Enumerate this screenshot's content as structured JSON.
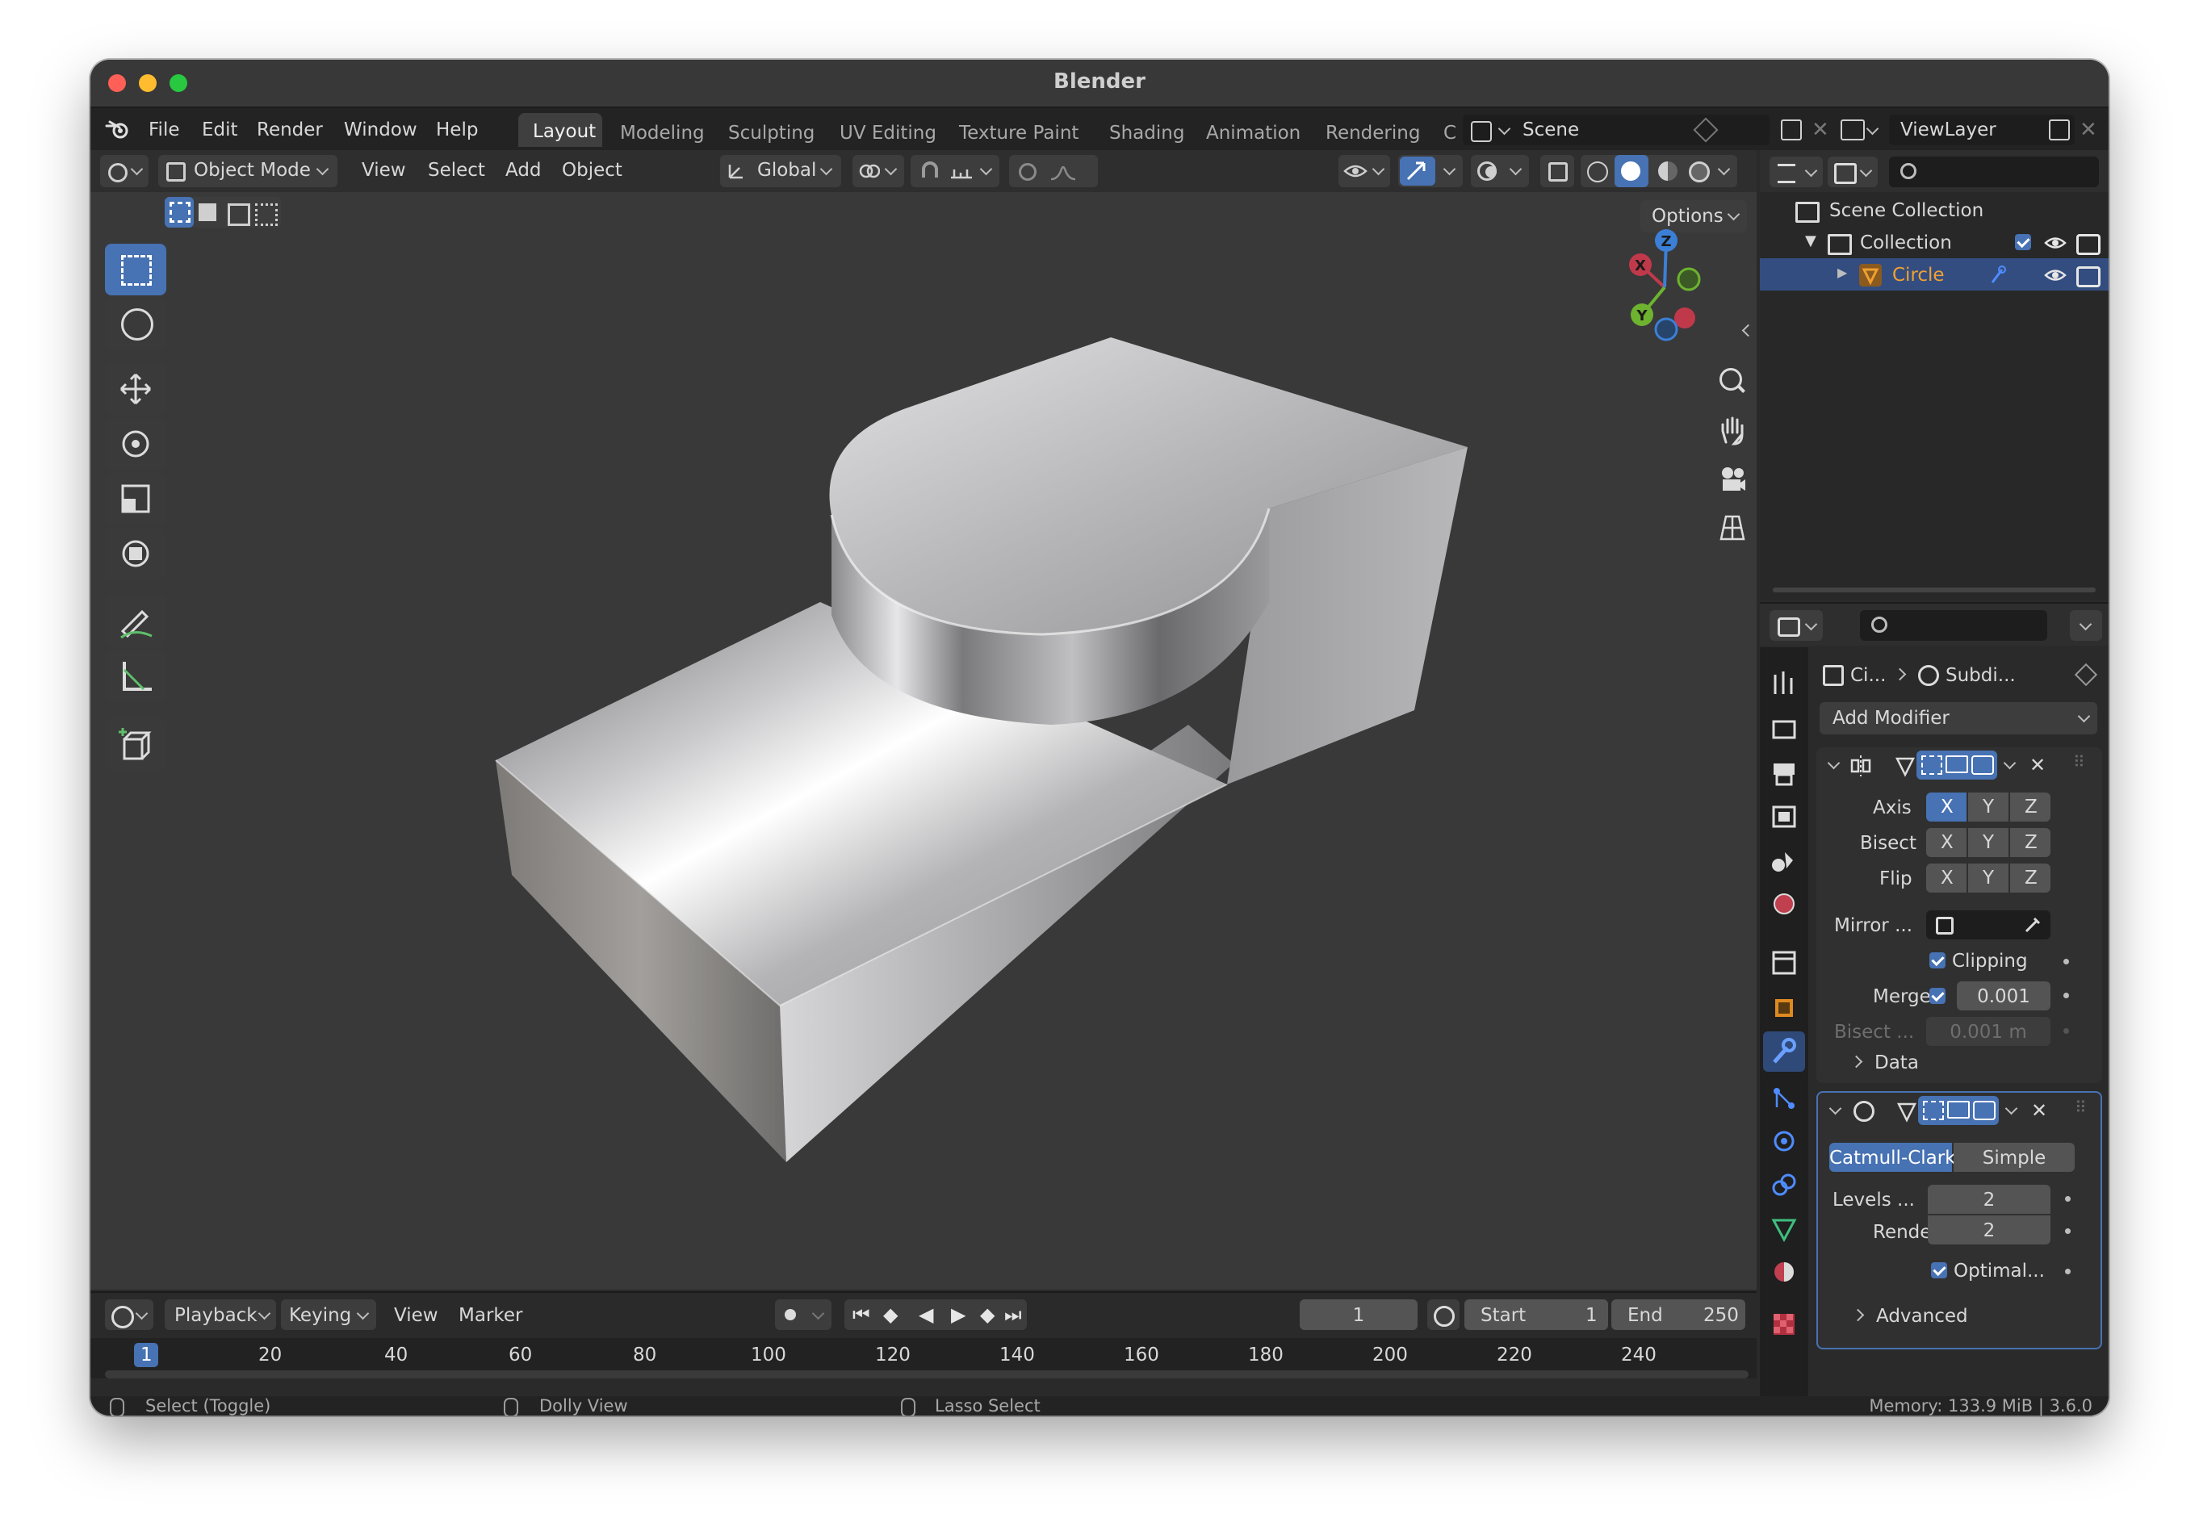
{
  "window": {
    "title": "Blender"
  },
  "menu": {
    "items": [
      "File",
      "Edit",
      "Render",
      "Window",
      "Help"
    ]
  },
  "workspaces": [
    "Layout",
    "Modeling",
    "Sculpting",
    "UV Editing",
    "Texture Paint",
    "Shading",
    "Animation",
    "Rendering",
    "C"
  ],
  "scene": {
    "name": "Scene",
    "view_layer": "ViewLayer"
  },
  "viewport_header": {
    "mode": "Object Mode",
    "menus": [
      "View",
      "Select",
      "Add",
      "Object"
    ],
    "orientation": "Global",
    "options": "Options"
  },
  "outliner": {
    "items": [
      {
        "label": "Scene Collection"
      },
      {
        "label": "Collection"
      },
      {
        "label": "Circle"
      }
    ]
  },
  "properties": {
    "breadcrumb": {
      "object": "Ci...",
      "modifier": "Subdi..."
    },
    "add_modifier": "Add Modifier",
    "mirror": {
      "axis_label": "Axis",
      "bisect_label": "Bisect",
      "flip_label": "Flip",
      "xyz": [
        "X",
        "Y",
        "Z"
      ],
      "mirror_obj_label": "Mirror ...",
      "clipping_label": "Clipping",
      "merge_label": "Merge",
      "merge_value": "0.001",
      "bisect_dist_label": "Bisect ...",
      "bisect_dist_value": "0.001 m",
      "data_label": "Data"
    },
    "subsurf": {
      "mode_options": [
        "Catmull-Clark",
        "Simple"
      ],
      "levels_label": "Levels ...",
      "levels_value": "2",
      "render_label": "Render",
      "render_value": "2",
      "optimal_label": "Optimal...",
      "advanced_label": "Advanced"
    }
  },
  "timeline": {
    "menus": [
      "Playback",
      "Keying",
      "View",
      "Marker"
    ],
    "current_frame": "1",
    "start_label": "Start",
    "start_value": "1",
    "end_label": "End",
    "end_value": "250",
    "ruler": [
      "1",
      "20",
      "40",
      "60",
      "80",
      "100",
      "120",
      "140",
      "160",
      "180",
      "200",
      "220",
      "240"
    ]
  },
  "status_bar": {
    "select": "Select (Toggle)",
    "dolly": "Dolly View",
    "lasso": "Lasso Select",
    "info": "Memory: 133.9 MiB | 3.6.0"
  },
  "gizmo": {
    "axes": [
      "X",
      "Y",
      "Z"
    ]
  },
  "colors": {
    "accent": "#4772b3",
    "active_object": "#f0a030",
    "background": "#2a2a2a",
    "viewport": "#393939"
  }
}
